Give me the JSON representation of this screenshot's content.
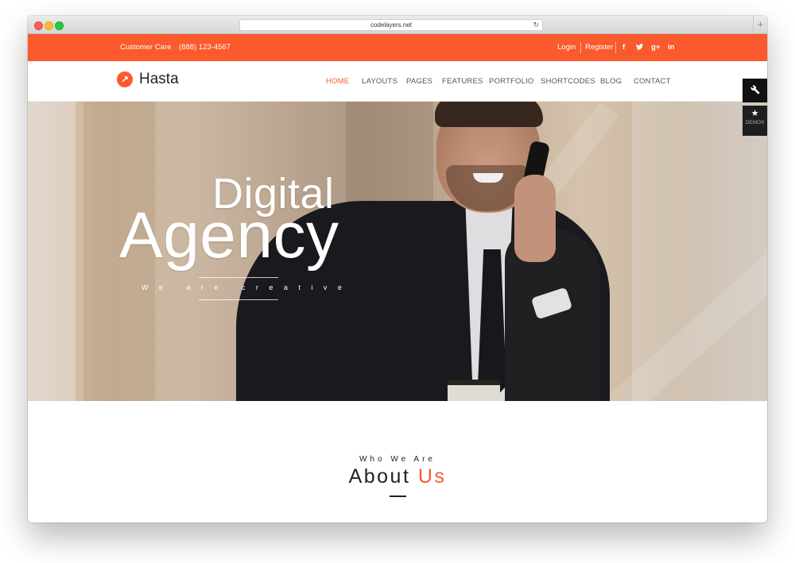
{
  "browser": {
    "url": "codelayers.net",
    "reload_icon": "reload-icon",
    "newtab_icon": "+"
  },
  "topbar": {
    "bg_color": "#fa5a2c",
    "customer_care": "Customer Care",
    "phone": "(888) 123-4567",
    "login": "Login",
    "register": "Register",
    "social": [
      "f",
      "t",
      "g+",
      "in"
    ]
  },
  "logo": {
    "name": "Hasta",
    "mark": "↗"
  },
  "nav": {
    "items": [
      "HOME",
      "LAYOUTS",
      "PAGES",
      "FEATURES",
      "PORTFOLIO",
      "SHORTCODES",
      "BLOG",
      "CONTACT"
    ],
    "active_index": 0,
    "active_color": "#fa5a2c"
  },
  "hero": {
    "line1": "Digital",
    "line2": "Agency",
    "tagline": "We are creative"
  },
  "side_panel": {
    "wrench_icon": "wrench-icon",
    "star_icon": "star-icon",
    "demos_label": "DEMOS"
  },
  "about": {
    "kicker": "Who We Are",
    "title_main": "About",
    "title_accent": "Us"
  }
}
